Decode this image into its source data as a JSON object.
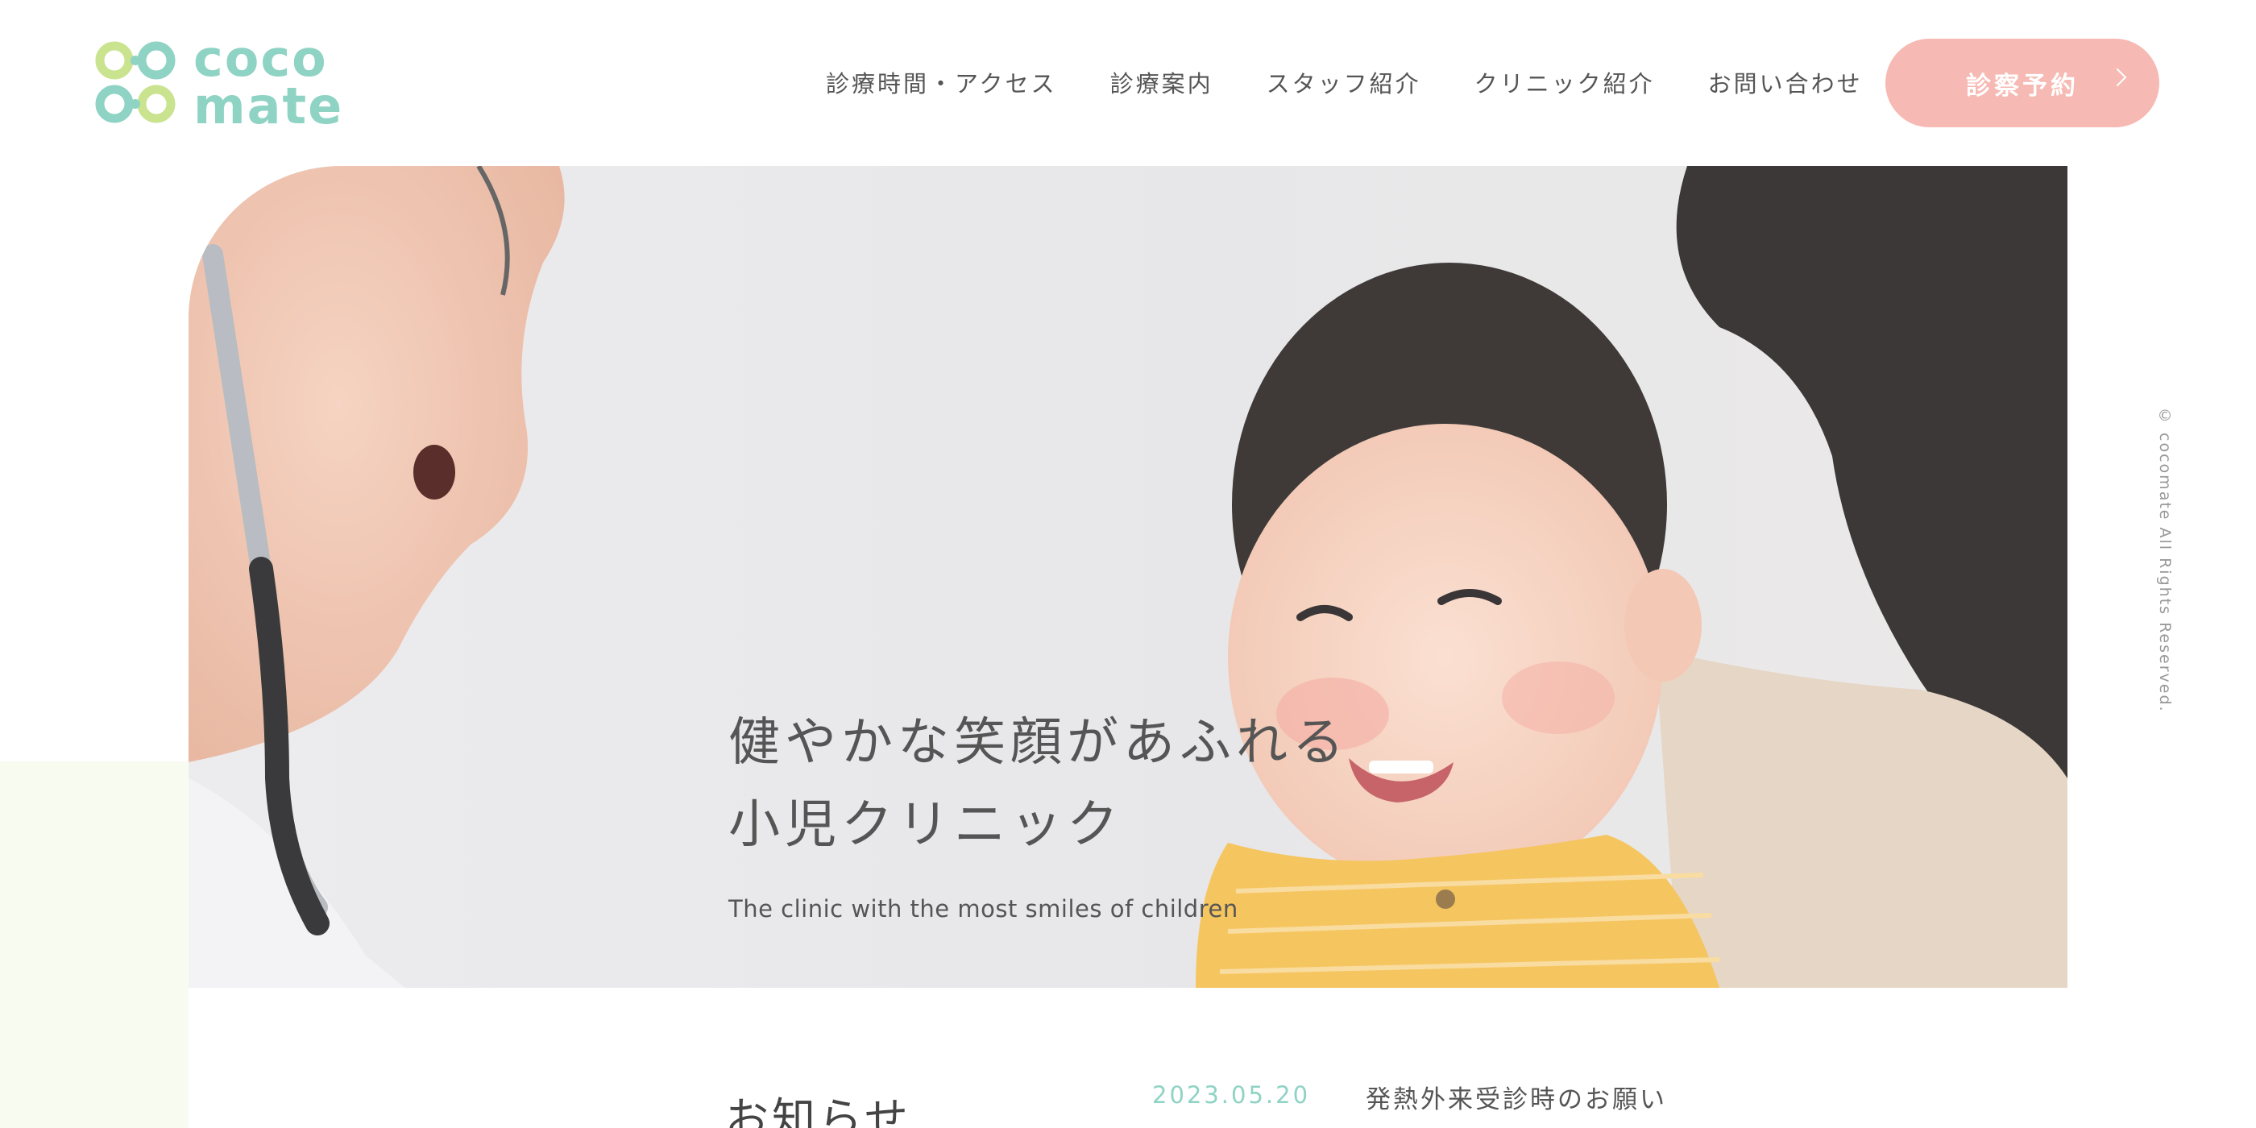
{
  "header": {
    "logo_line1": "coco",
    "logo_line2": "mate",
    "nav": [
      {
        "label": "診療時間・アクセス"
      },
      {
        "label": "診療案内"
      },
      {
        "label": "スタッフ紹介"
      },
      {
        "label": "クリニック紹介"
      },
      {
        "label": "お問い合わせ"
      }
    ],
    "reserve_label": "診察予約"
  },
  "hero": {
    "title_line1": "健やかな笑顔があふれる",
    "title_line2": "小児クリニック",
    "subtitle": "The clinic with the most smiles of children"
  },
  "news": {
    "heading": "お知らせ",
    "items": [
      {
        "date": "2023.05.20",
        "title": "発熱外来受診時のお願い"
      }
    ]
  },
  "footer": {
    "copyright": "© cocomate All Rights Reserved."
  },
  "colors": {
    "brand_mint": "#8fd3c4",
    "brand_lime": "#c9e38f",
    "reserve_pink": "#f6b9b3"
  }
}
